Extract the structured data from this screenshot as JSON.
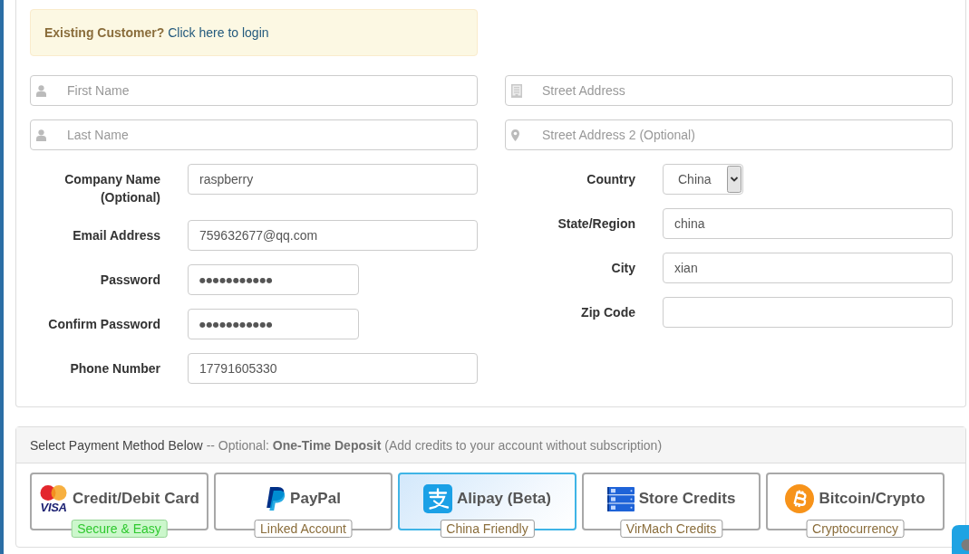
{
  "login_alert": {
    "prompt": "Existing Customer?",
    "link": "Click here to login"
  },
  "left_column": {
    "icon_fields": [
      {
        "kind": "name",
        "placeholder": "First Name"
      },
      {
        "kind": "name",
        "placeholder": "Last Name"
      }
    ],
    "rows": [
      {
        "label": "Company Name (Optional)",
        "kind": "text",
        "value": "raspberry"
      },
      {
        "label": "Email Address",
        "kind": "text",
        "value": "759632677@qq.com"
      },
      {
        "label": "Password",
        "kind": "password",
        "value": "●●●●●●●●●●●"
      },
      {
        "label": "Confirm Password",
        "kind": "password",
        "value": "●●●●●●●●●●●"
      },
      {
        "label": "Phone Number",
        "kind": "text",
        "value": "17791605330"
      }
    ]
  },
  "right_column": {
    "icon_fields": [
      {
        "kind": "address",
        "placeholder": "Street Address"
      },
      {
        "kind": "address2",
        "placeholder": "Street Address 2 (Optional)"
      }
    ],
    "rows": [
      {
        "label": "Country",
        "kind": "select",
        "value": "China"
      },
      {
        "label": "State/Region",
        "kind": "text",
        "value": "china"
      },
      {
        "label": "City",
        "kind": "text",
        "value": "xian"
      },
      {
        "label": "Zip Code",
        "kind": "text"
      }
    ]
  },
  "payment": {
    "heading": "Select Payment Method Below",
    "note": "-- Optional: **One-Time Deposit** (Add credits to your account without subscription)",
    "methods": [
      {
        "kind": "card",
        "title": "Credit/Debit Card",
        "logo_text": "VISA",
        "selected": false,
        "badge": {
          "text": "Secure & Easy",
          "kind": "success"
        }
      },
      {
        "kind": "paypal",
        "title": "PayPal",
        "selected": false,
        "badge": {
          "text": "Linked Account",
          "kind": "plain"
        }
      },
      {
        "kind": "alipay",
        "title": "Alipay (Beta)",
        "selected": true,
        "badge": {
          "text": "China Friendly",
          "kind": "plain"
        }
      },
      {
        "kind": "credits",
        "title": "Store Credits",
        "selected": false,
        "badge": {
          "text": "VirMach Credits",
          "kind": "plain"
        }
      },
      {
        "kind": "crypto",
        "title": "Bitcoin/Crypto",
        "selected": false,
        "badge": {
          "text": "Cryptocurrency",
          "kind": "plain"
        }
      }
    ]
  }
}
